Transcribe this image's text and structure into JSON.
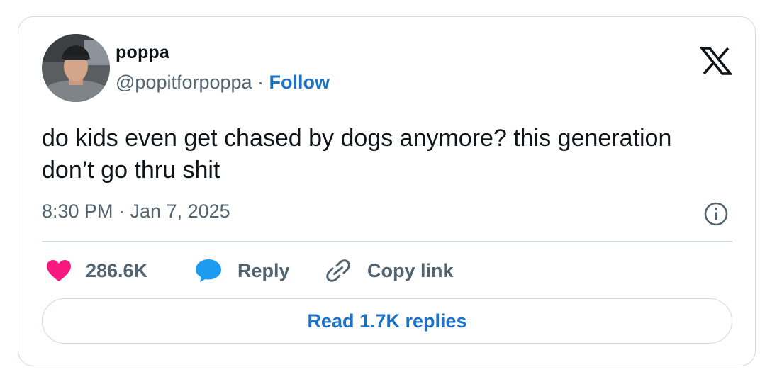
{
  "author": {
    "name": "poppa",
    "handle": "@popitforpoppa",
    "separator": " · ",
    "follow_label": "Follow",
    "avatar_icon": "profile-photo"
  },
  "platform_icon": "x-logo-icon",
  "tweet": {
    "text": "do kids even get chased by dogs anymore? this generation don’t go thru shit",
    "timestamp": "8:30 PM · Jan 7, 2025"
  },
  "actions": {
    "like_count": "286.6K",
    "reply_label": "Reply",
    "copy_link_label": "Copy link"
  },
  "read_replies_label": "Read 1.7K replies",
  "colors": {
    "text": "#0f1419",
    "secondary": "#536471",
    "link": "#1d72c7",
    "heart": "#f91880",
    "reply_bubble": "#1d9bf0",
    "border": "#cfd9de"
  }
}
